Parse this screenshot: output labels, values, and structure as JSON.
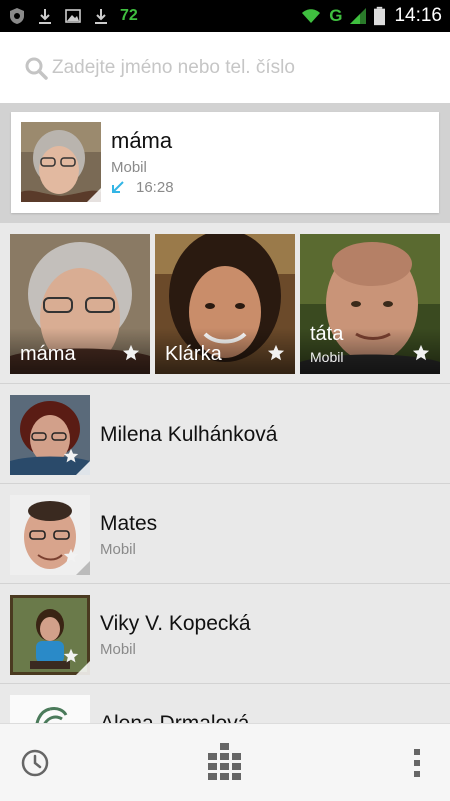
{
  "status_bar": {
    "battery_level": "72",
    "network_type": "G",
    "time": "14:16",
    "left_icons": [
      "shield-icon",
      "download-icon",
      "image-icon",
      "download-icon"
    ],
    "right_icons": [
      "wifi-icon",
      "signal-icon",
      "battery-icon"
    ]
  },
  "search": {
    "placeholder": "Zadejte jméno nebo tel. číslo",
    "value": "",
    "icon": "search-icon"
  },
  "recent": {
    "name": "máma",
    "type": "Mobil",
    "time": "16:28",
    "call_icon": "incoming-call-icon"
  },
  "favorites": [
    {
      "name": "máma",
      "subtitle": "",
      "icon": "star-icon"
    },
    {
      "name": "Klárka",
      "subtitle": "",
      "icon": "star-icon"
    },
    {
      "name": "táta",
      "subtitle": "Mobil",
      "icon": "star-icon"
    }
  ],
  "contacts": [
    {
      "name": "Milena Kulhánková",
      "type": ""
    },
    {
      "name": "Mates",
      "type": "Mobil"
    },
    {
      "name": "Viky V. Kopecká",
      "type": "Mobil"
    },
    {
      "name": "Alena Drmalová",
      "type": ""
    }
  ],
  "bottom_bar": {
    "left_icon": "history-icon",
    "center_icon": "dialpad-icon",
    "right_icon": "overflow-menu-icon"
  },
  "colors": {
    "accent": "#33b5e5",
    "status_green": "#3fbf3f",
    "background": "#e9e9e9"
  }
}
